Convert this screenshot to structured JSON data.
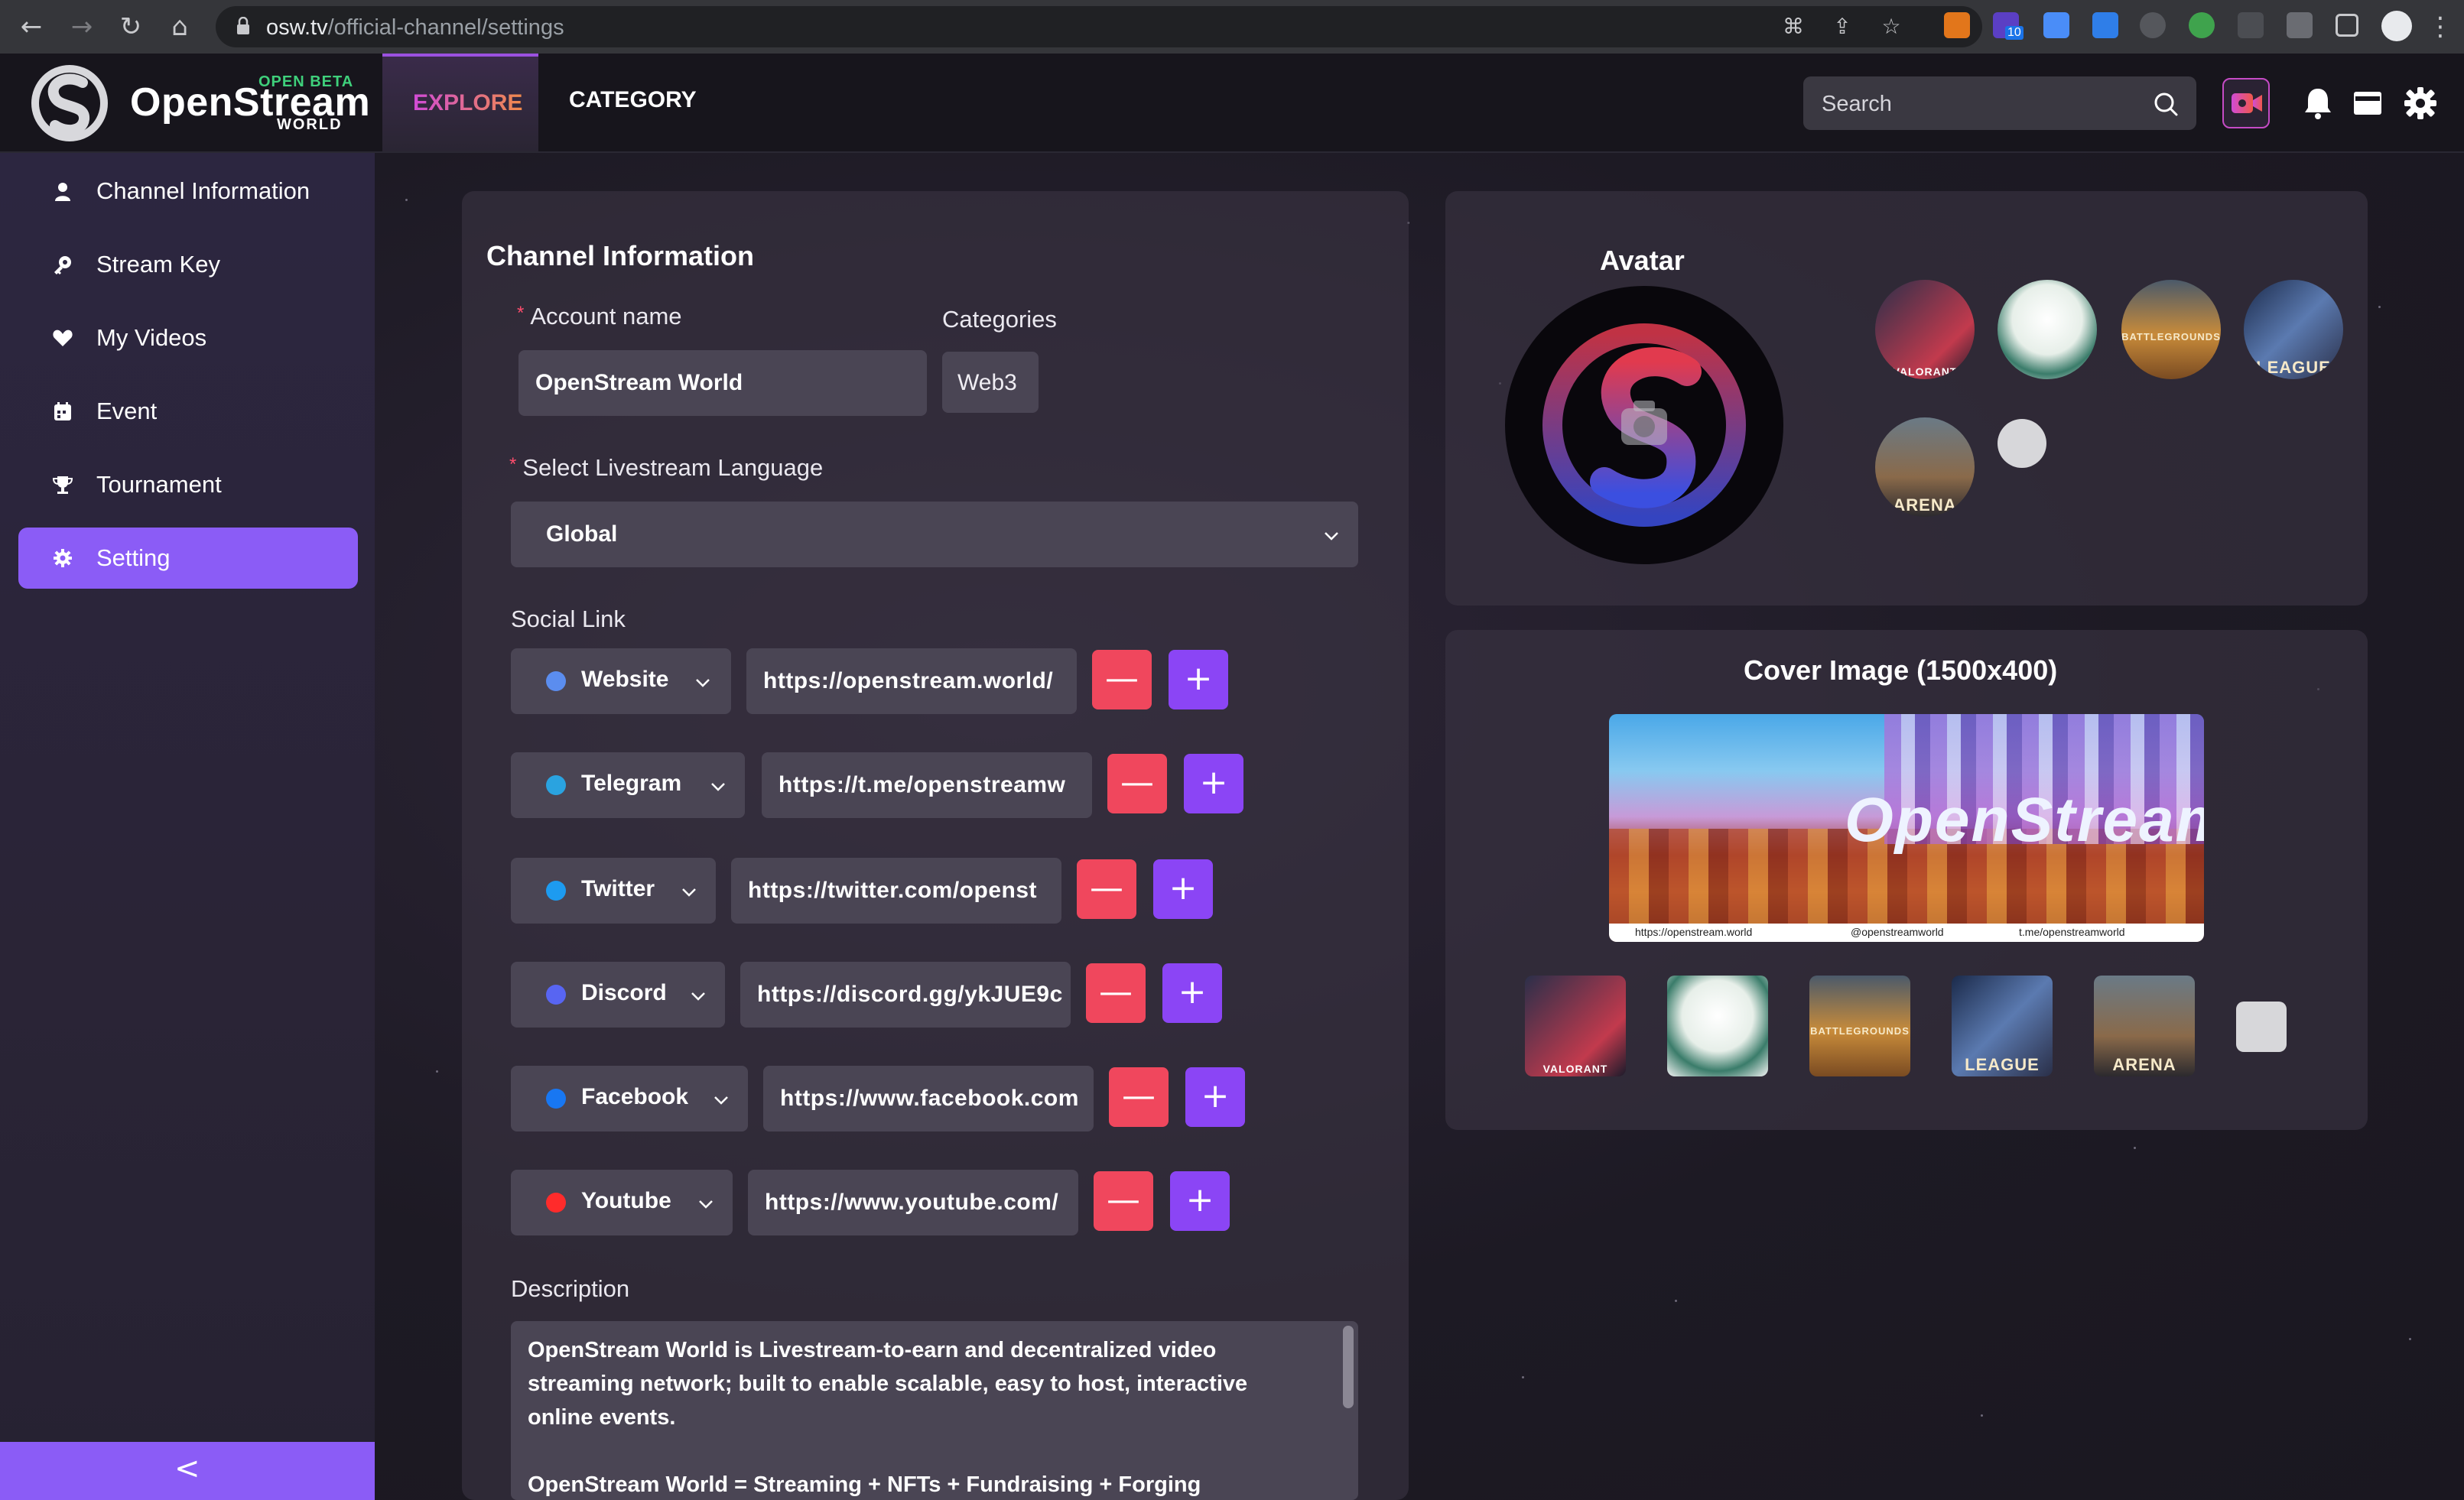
{
  "browser": {
    "url_domain": "osw.tv",
    "url_path": "/official-channel/settings",
    "ext_badge": "10"
  },
  "header": {
    "logo_name": "OpenStream",
    "logo_badge": "OPEN BETA",
    "logo_sub": "WORLD",
    "nav": {
      "explore": "EXPLORE",
      "category": "CATEGORY"
    },
    "search_placeholder": "Search"
  },
  "sidebar": {
    "items": [
      {
        "label": "Channel Information",
        "icon": "user-icon"
      },
      {
        "label": "Stream Key",
        "icon": "key-icon"
      },
      {
        "label": "My Videos",
        "icon": "heart-icon"
      },
      {
        "label": "Event",
        "icon": "calendar-icon"
      },
      {
        "label": "Tournament",
        "icon": "trophy-icon"
      },
      {
        "label": "Setting",
        "icon": "gear-icon",
        "active": true
      }
    ],
    "collapse": "<"
  },
  "channel_info": {
    "title": "Channel Information",
    "account_label": "Account name",
    "account_value": "OpenStream World",
    "categories_label": "Categories",
    "category_value": "Web3",
    "language_label": "Select Livestream Language",
    "language_value": "Global",
    "social_label": "Social Link",
    "socials": [
      {
        "name": "Website",
        "url": "https://openstream.world/",
        "color": "#5b8def"
      },
      {
        "name": "Telegram",
        "url": "https://t.me/openstreamw",
        "color": "#2aa3e0"
      },
      {
        "name": "Twitter",
        "url": "https://twitter.com/openst",
        "color": "#1d9bf0"
      },
      {
        "name": "Discord",
        "url": "https://discord.gg/ykJUE9c",
        "color": "#5865f2"
      },
      {
        "name": "Facebook",
        "url": "https://www.facebook.com",
        "color": "#1877f2"
      },
      {
        "name": "Youtube",
        "url": "https://www.youtube.com/",
        "color": "#ff2b2b"
      }
    ],
    "minus": "—",
    "plus": "+",
    "description_label": "Description",
    "description": "OpenStream World is Livestream-to-earn and decentralized video\nstreaming network; built to enable scalable, easy to host, interactive\nonline events.\n\nOpenStream World = Streaming + NFTs + Fundraising + Forging"
  },
  "avatar": {
    "title": "Avatar",
    "thumb_captions": [
      "VALORANT",
      "",
      "BATTLEGROUNDS",
      "LEAGUE",
      "ARENA"
    ]
  },
  "cover": {
    "title": "Cover Image (1500x400)",
    "banner_text": "OpenStream",
    "footer": [
      "https://openstream.world",
      "@openstreamworld",
      "t.me/openstreamworld"
    ],
    "thumb_captions": [
      "VALORANT",
      "",
      "BATTLEGROUNDS",
      "LEAGUE",
      "ARENA"
    ]
  },
  "colors": {
    "accent": "#8b5cf6",
    "danger": "#f0475d",
    "plus": "#8b45f5",
    "beta": "#3fd07b"
  }
}
